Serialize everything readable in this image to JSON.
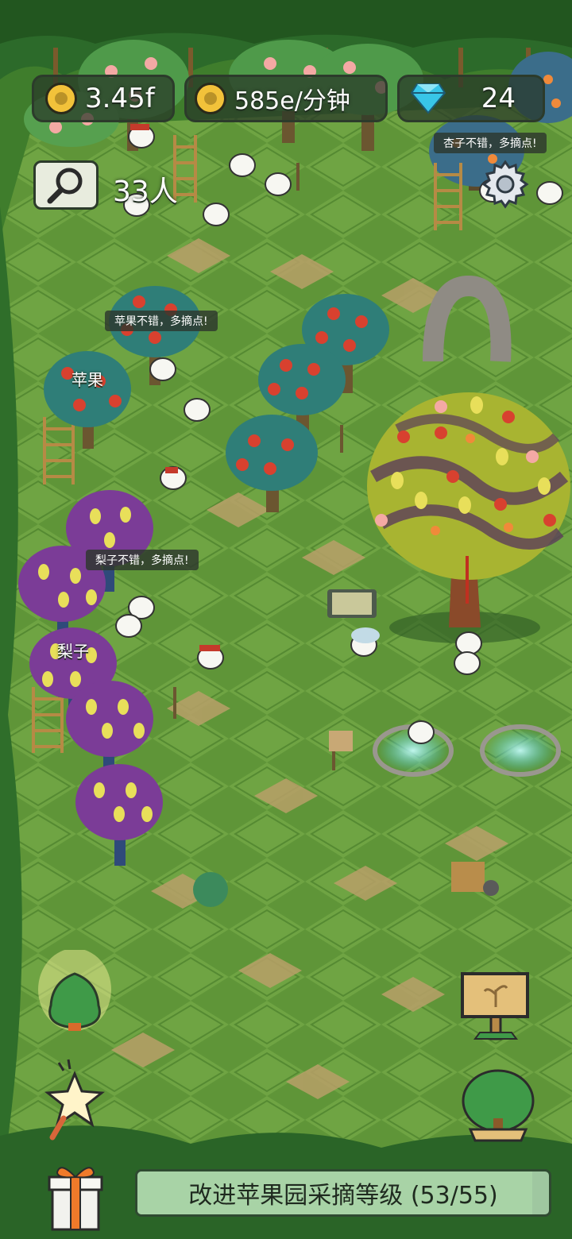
{
  "hud": {
    "gold": "3.45f",
    "rate": "585e/分钟",
    "gems": "24",
    "visitors": "33人"
  },
  "bubbles": {
    "apricot": "杏子不错，多摘点!",
    "apple": "苹果不错，多摘点!",
    "pear": "梨子不错，多摘点!"
  },
  "labels": {
    "apple": "苹果",
    "pear": "梨子"
  },
  "bottom": {
    "upgrade_text": "改进苹果园采摘等级 (53/55)",
    "progress_fraction": 0.96
  },
  "colors": {
    "grass": "#4f8f33",
    "tile_light": "#74a846",
    "tile_dark": "#5f9538",
    "dirt": "#b9a06a",
    "apple": "#d8412f",
    "pear_leaf": "#7b3c97",
    "pear_fruit": "#e8df5a"
  },
  "icons": {
    "search": "magnifier-icon",
    "settings": "gear-icon",
    "gem": "diamond-icon",
    "gift": "gift-icon",
    "star": "star-icon",
    "sign": "sprout-sign-icon",
    "tree": "bonsai-icon"
  }
}
